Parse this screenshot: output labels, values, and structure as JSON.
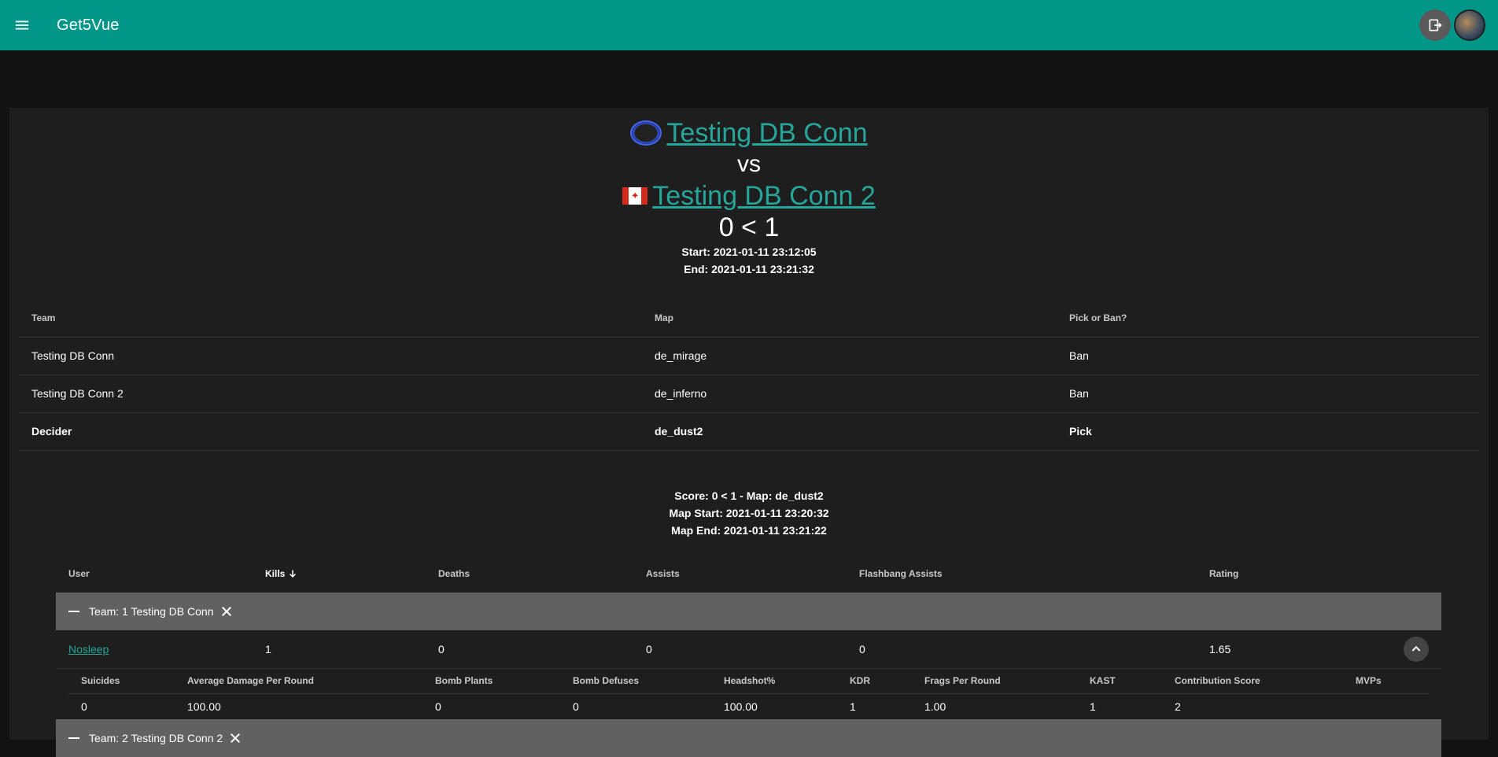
{
  "app": {
    "title": "Get5Vue"
  },
  "match": {
    "team1": "Testing DB Conn",
    "vs": "vs",
    "team2": "Testing DB Conn 2",
    "score": "0 < 1",
    "start": "Start: 2021-01-11 23:12:05",
    "end": "End: 2021-01-11 23:21:32"
  },
  "veto": {
    "headers": [
      "Team",
      "Map",
      "Pick or Ban?"
    ],
    "rows": [
      [
        "Testing DB Conn",
        "de_mirage",
        "Ban"
      ],
      [
        "Testing DB Conn 2",
        "de_inferno",
        "Ban"
      ],
      [
        "Decider",
        "de_dust2",
        "Pick"
      ]
    ]
  },
  "map": {
    "score": "Score: 0 < 1 - Map: de_dust2",
    "start": "Map Start: 2021-01-11 23:20:32",
    "end": "Map End: 2021-01-11 23:21:22"
  },
  "stats": {
    "headers": [
      "User",
      "Kills",
      "Deaths",
      "Assists",
      "Flashbang Assists",
      "Rating"
    ],
    "group1": "Team: 1 Testing DB Conn",
    "group2": "Team: 2 Testing DB Conn 2",
    "player": [
      "Nosleep",
      "1",
      "0",
      "0",
      "0",
      "1.65"
    ],
    "detail_headers": [
      "Suicides",
      "Average Damage Per Round",
      "Bomb Plants",
      "Bomb Defuses",
      "Headshot%",
      "KDR",
      "Frags Per Round",
      "KAST",
      "Contribution Score",
      "MVPs"
    ],
    "detail_values": [
      "0",
      "100.00",
      "0",
      "0",
      "100.00",
      "1",
      "1.00",
      "1",
      "2",
      ""
    ]
  },
  "icons": [
    "menu-icon",
    "logout-icon",
    "user-avatar",
    "team1-logo",
    "canada-flag-icon",
    "sort-arrow-down-icon",
    "collapse-icon",
    "close-icon",
    "chevron-up-icon"
  ],
  "colors": {
    "primary": "#009688",
    "link": "#26a69a",
    "group_row": "#616161"
  }
}
